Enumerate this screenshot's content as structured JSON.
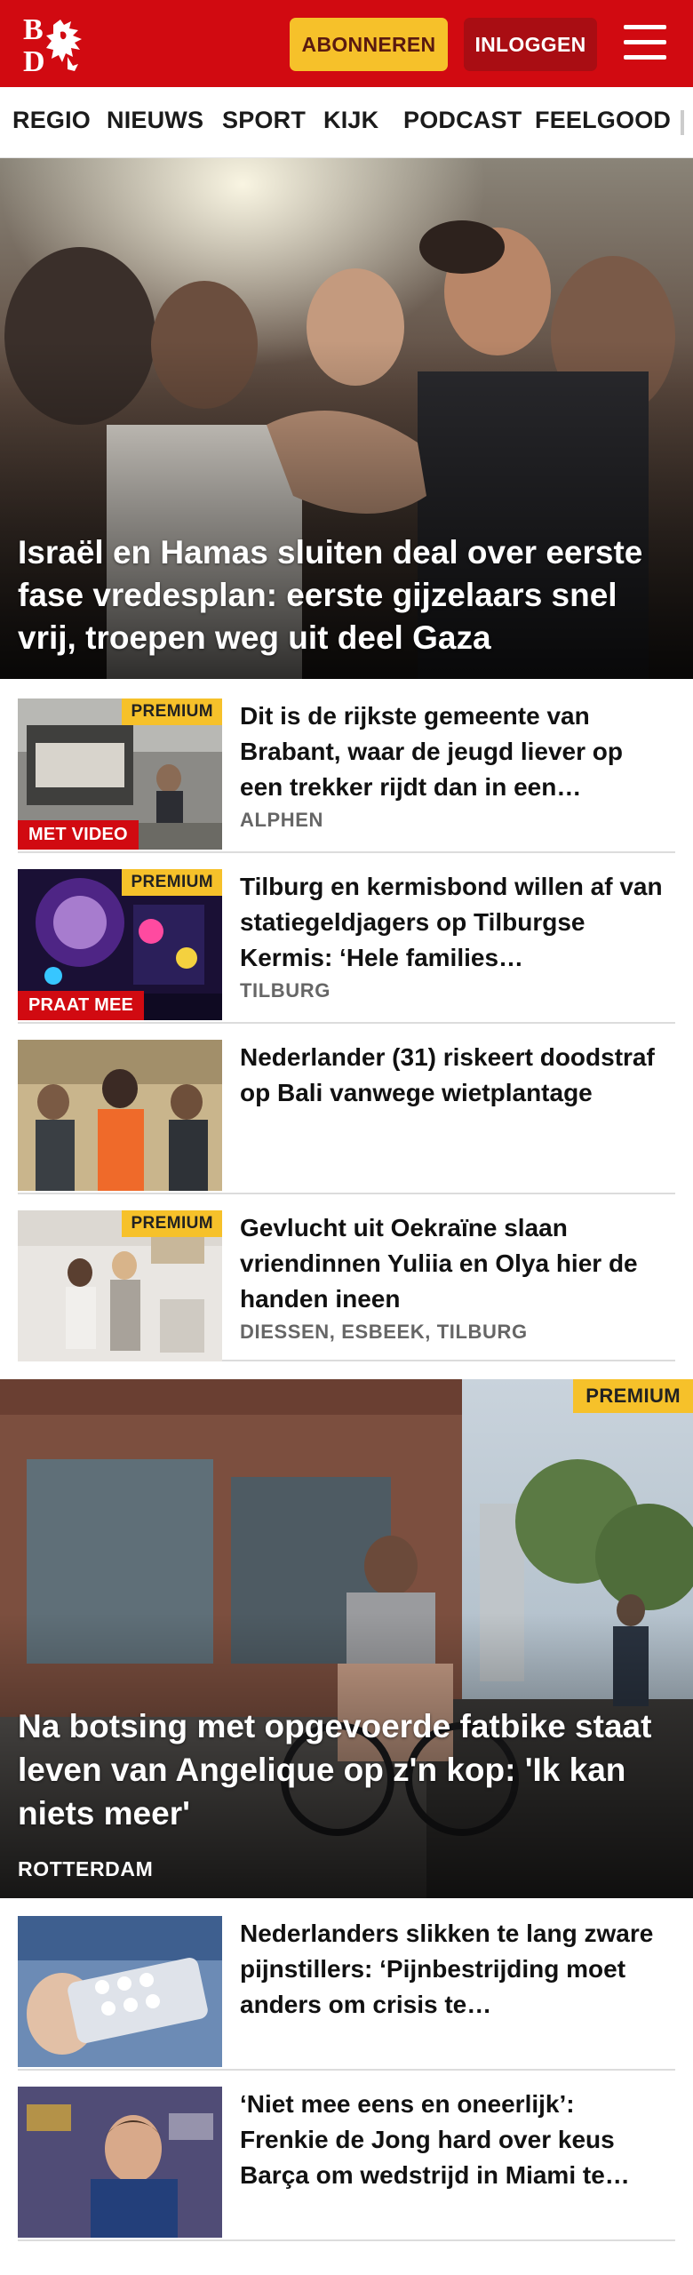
{
  "header": {
    "logo_alt": "BD",
    "subscribe_label": "ABONNEREN",
    "login_label": "INLOGGEN",
    "menu_icon": "hamburger-menu-icon",
    "brand_color": "#d10a11",
    "subscribe_color": "#f6c12a"
  },
  "nav": {
    "items": [
      "REGIO",
      "NIEUWS",
      "SPORT",
      "KIJK",
      "PODCAST",
      "FEELGOOD"
    ]
  },
  "hero": {
    "title": "Israël en Hamas sluiten deal over eerste fase vredesplan: eerste gijzelaars snel vrij, troepen weg uit deel Gaza"
  },
  "articles": [
    {
      "title": "Dit is de rijkste gemeente van Brabant, waar de jeugd liever op een trekker rijdt dan in een…",
      "location": "ALPHEN",
      "premium": "PREMIUM",
      "tag": "MET VIDEO"
    },
    {
      "title": "Tilburg en kermisbond willen af van statiegeldjagers op Tilburgse Kermis: ‘Hele families…",
      "location": "TILBURG",
      "premium": "PREMIUM",
      "tag": "PRAAT MEE"
    },
    {
      "title": "Nederlander (31) riskeert doodstraf op Bali vanwege wietplantage",
      "location": "",
      "premium": "",
      "tag": ""
    },
    {
      "title": "Gevlucht uit Oekraïne slaan vriendinnen Yuliia en Olya hier de handen ineen",
      "location": "DIESSEN, ESBEEK, TILBURG",
      "premium": "PREMIUM",
      "tag": ""
    }
  ],
  "feature": {
    "title": "Na botsing met opgevoerde fatbike staat leven van Angelique op z'n kop: 'Ik kan niets meer'",
    "location": "ROTTERDAM",
    "premium": "PREMIUM"
  },
  "articles2": [
    {
      "title": "Nederlanders slikken te lang zware pijnstillers: ‘Pijnbestrij­ding moet anders om crisis te…",
      "location": "",
      "premium": "",
      "tag": ""
    },
    {
      "title": "‘Niet mee eens en oneerlijk’: Frenkie de Jong hard over keus Barça om wedstrijd in Miami te…",
      "location": "",
      "premium": "",
      "tag": ""
    }
  ]
}
